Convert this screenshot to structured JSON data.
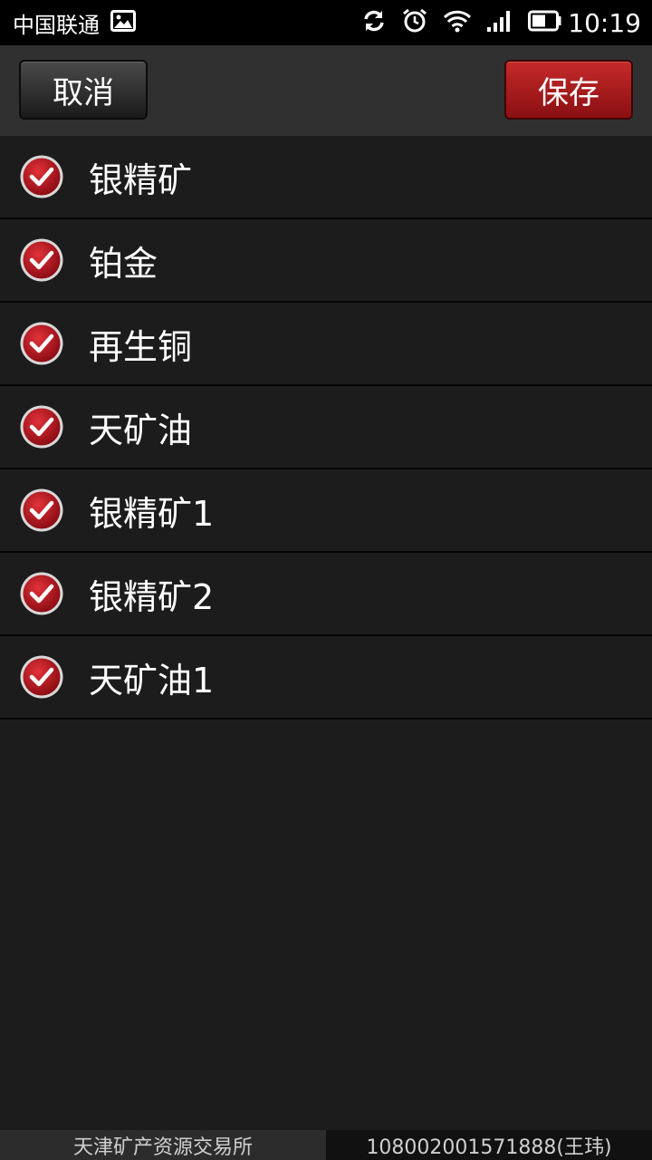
{
  "status_bar": {
    "carrier": "中国联通",
    "time": "10:19",
    "icons": [
      "image-icon",
      "sync-icon",
      "alarm-icon",
      "wifi-icon",
      "signal-icon",
      "battery-icon"
    ]
  },
  "toolbar": {
    "cancel_label": "取消",
    "save_label": "保存"
  },
  "list": {
    "items": [
      {
        "label": "银精矿",
        "checked": true
      },
      {
        "label": "铂金",
        "checked": true
      },
      {
        "label": "再生铜",
        "checked": true
      },
      {
        "label": "天矿油",
        "checked": true
      },
      {
        "label": "银精矿1",
        "checked": true
      },
      {
        "label": "银精矿2",
        "checked": true
      },
      {
        "label": "天矿油1",
        "checked": true
      }
    ]
  },
  "footer": {
    "left": "天津矿产资源交易所",
    "right": "108002001571888(王玮)"
  },
  "colors": {
    "accent": "#a8141c",
    "background": "#1c1c1c",
    "actionbar": "#303030"
  }
}
